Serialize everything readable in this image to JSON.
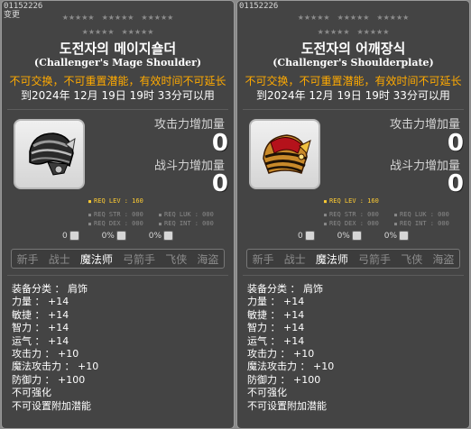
{
  "panels": [
    {
      "item_id": "01152226",
      "change_label": "变更",
      "title_ko": "도전자의 메이지숄더",
      "title_en": "(Challenger's Mage Shoulder)",
      "notice": "不可交换，不可重置潜能，有效时间不可延长",
      "expiry": "到2024年 12月 19日 19时 33分可以用",
      "attack_label": "攻击力增加量",
      "attack_value": "0",
      "combat_label": "战斗力增加量",
      "combat_value": "0",
      "req_lev": "REQ LEV : 160",
      "req_str": "REQ STR : 000",
      "req_luk": "REQ LUK : 000",
      "req_dex": "REQ DEX : 000",
      "req_int": "REQ INT : 000",
      "mini": [
        "0",
        "0%",
        "0%"
      ],
      "classes": [
        "新手",
        "战士",
        "魔法师",
        "弓箭手",
        "飞侠",
        "海盗"
      ],
      "active_class": "魔法师",
      "attributes": [
        "装备分类 ： 肩饰",
        "力量 ： +14",
        "敏捷 ： +14",
        "智力 ： +14",
        "运气 ： +14",
        "攻击力 ： +10",
        "魔法攻击力 ： +10",
        "防御力 ： +100",
        "不可强化",
        "不可设置附加潜能"
      ]
    },
    {
      "item_id": "01152226",
      "title_ko": "도전자의 어깨장식",
      "title_en": "(Challenger's Shoulderplate)",
      "notice": "不可交换，不可重置潜能，有效时间不可延长",
      "expiry": "到2024年 12月 19日 19时 33分可以用",
      "attack_label": "攻击力增加量",
      "attack_value": "0",
      "combat_label": "战斗力增加量",
      "combat_value": "0",
      "req_lev": "REQ LEV : 160",
      "req_str": "REQ STR : 000",
      "req_luk": "REQ LUK : 000",
      "req_dex": "REQ DEX : 000",
      "req_int": "REQ INT : 000",
      "mini": [
        "0",
        "0%",
        "0%"
      ],
      "classes": [
        "新手",
        "战士",
        "魔法师",
        "弓箭手",
        "飞侠",
        "海盗"
      ],
      "active_class": "魔法师",
      "attributes": [
        "装备分类 ： 肩饰",
        "力量 ： +14",
        "敏捷 ： +14",
        "智力 ： +14",
        "运气 ： +14",
        "攻击力 ： +10",
        "魔法攻击力 ： +10",
        "防御力 ： +100",
        "不可强化",
        "不可设置附加潜能"
      ]
    }
  ],
  "icons": [
    "mage-shoulder-icon",
    "shoulderplate-icon",
    "cube-icon",
    "scroll-icon",
    "hammer-icon"
  ]
}
